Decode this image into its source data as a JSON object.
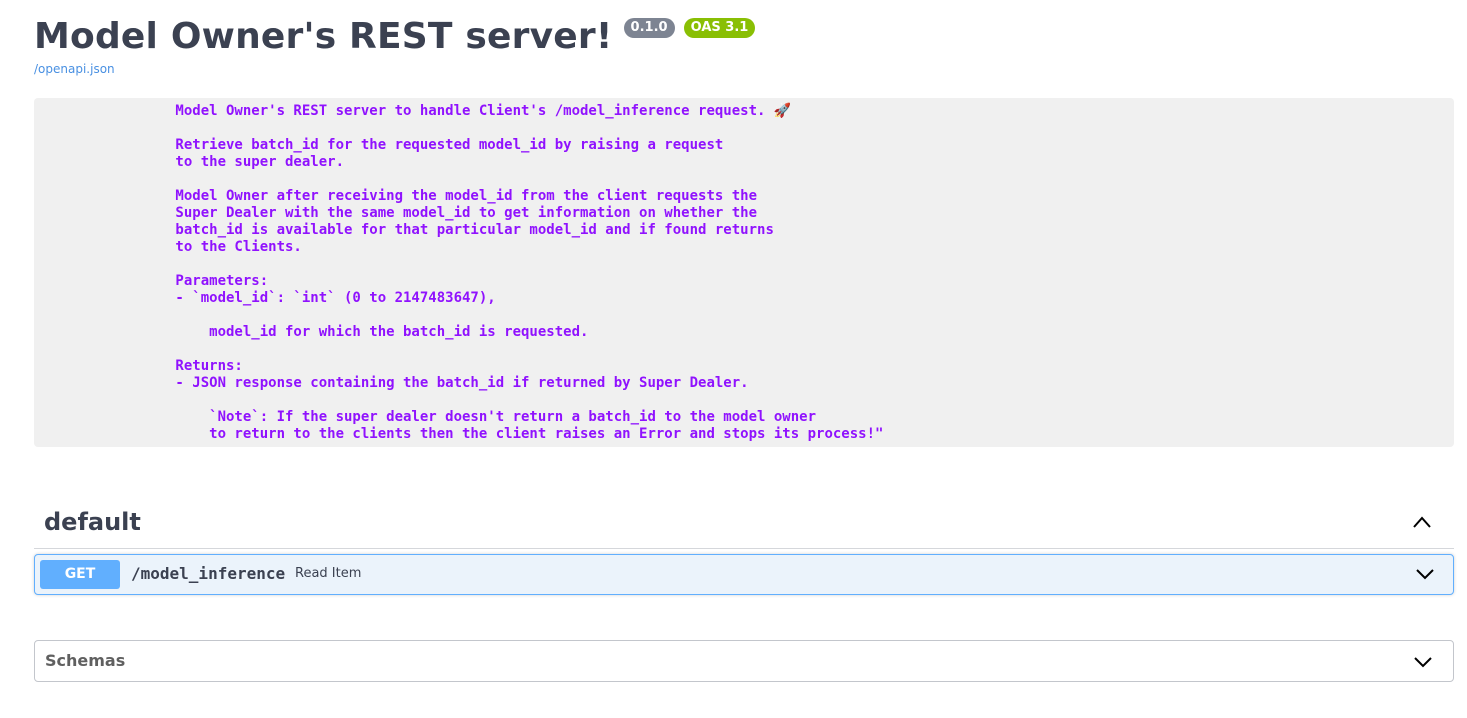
{
  "info": {
    "title": "Model Owner's REST server!",
    "version_badge": "0.1.0",
    "oas_badge": "OAS 3.1",
    "spec_link": "/openapi.json",
    "description": "        Model Owner's REST server to handle Client's /model_inference request. 🚀\n\n        Retrieve batch_id for the requested model_id by raising a request\n        to the super dealer.\n\n        Model Owner after receiving the model_id from the client requests the\n        Super Dealer with the same model_id to get information on whether the\n        batch_id is available for that particular model_id and if found returns\n        to the Clients.\n\n        Parameters:\n        - `model_id`: `int` (0 to 2147483647),\n\n            model_id for which the batch_id is requested.\n\n        Returns:\n        - JSON response containing the batch_id if returned by Super Dealer.\n\n            `Note`: If the super dealer doesn't return a batch_id to the model owner\n            to return to the clients then the client raises an Error and stops its process!\""
  },
  "tag": {
    "name": "default",
    "chevron_icon": "chevron-up-icon"
  },
  "operation": {
    "method": "GET",
    "path": "/model_inference",
    "summary": "Read Item",
    "chevron_icon": "chevron-down-icon",
    "method_color": "#61affe"
  },
  "schemas": {
    "title": "Schemas",
    "chevron_icon": "chevron-down-icon"
  }
}
